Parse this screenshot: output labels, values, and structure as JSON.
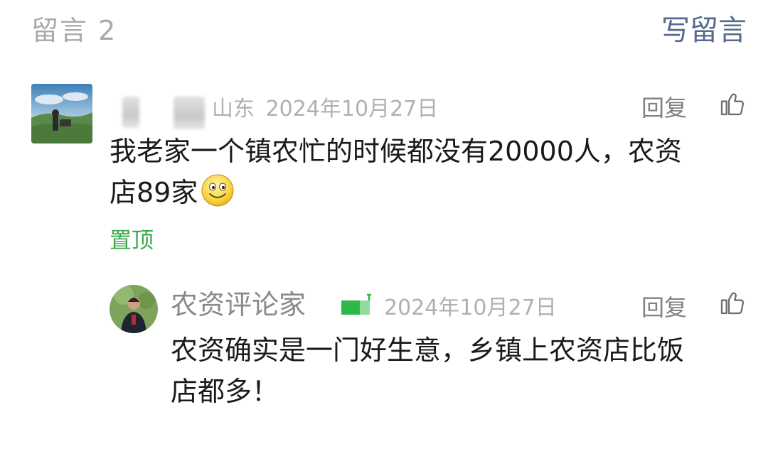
{
  "header": {
    "count_label": "留言 2",
    "write_label": "写留言"
  },
  "comment": {
    "location": "山东",
    "date": "2024年10月27日",
    "reply_label": "回复",
    "text_line1": "我老家一个镇农忙的时候都没有20000人，农资",
    "text_line2": "店89家",
    "emoji": "smile-emoji",
    "pinned_label": "置顶"
  },
  "reply": {
    "author": "农资评论家",
    "date": "2024年10月27日",
    "reply_label": "回复",
    "text_line1": "农资确实是一门好生意，乡镇上农资店比饭",
    "text_line2": "店都多！"
  },
  "colors": {
    "link_blue": "#57698f",
    "pinned_green": "#3aaa4e",
    "muted_gray": "#a9a9a9"
  },
  "icons": {
    "like": "thumbs-up-icon",
    "badge": "author-badge-icon"
  }
}
